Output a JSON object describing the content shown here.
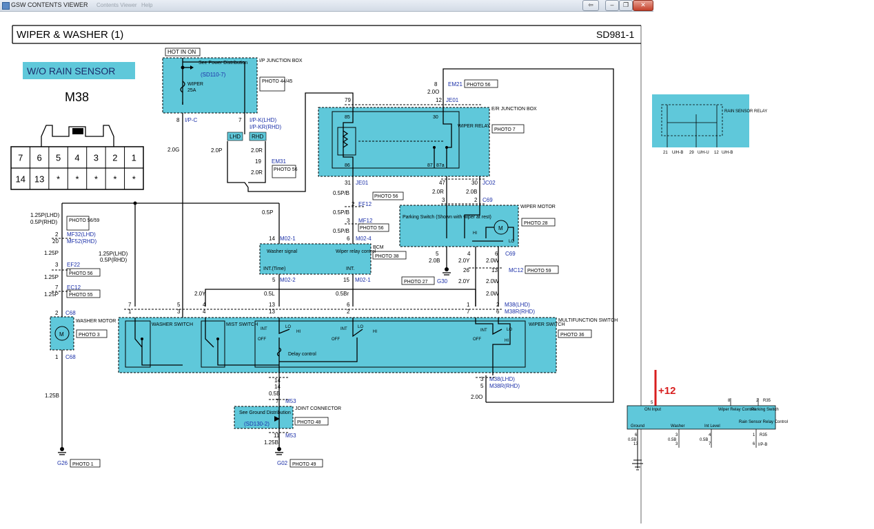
{
  "window": {
    "app_title": "GSW CONTENTS VIEWER",
    "faded_tabs": [
      "Contents Viewer",
      "Help"
    ],
    "controls": [
      "⇦",
      "⇨",
      "–",
      "❐",
      "✕"
    ]
  },
  "header": {
    "title": "WIPER & WASHER (1)",
    "code": "SD981-1"
  },
  "connector_view": {
    "variant_label": "W/O RAIN SENSOR",
    "connector_id": "M38",
    "pin_row1": [
      "7",
      "6",
      "5",
      "4",
      "3",
      "2",
      "1"
    ],
    "pin_row2": [
      "14",
      "13",
      "*",
      "*",
      "*",
      "*",
      "*"
    ]
  },
  "ip_junction": {
    "hot_label": "HOT IN ON",
    "box_name": "I/P JUNCTION BOX",
    "see_power": "See Power Distribution",
    "see_power_ref": "(SD110-7)",
    "fuse_name": "WIPER",
    "fuse_amp": "25A",
    "photo": "PHOTO 44/45"
  },
  "er_junction": {
    "box_name": "E/R JUNCTION BOX",
    "photo": "PHOTO 7",
    "relay_name": "WIPER RELAY"
  },
  "wiper_motor": {
    "name": "WIPER MOTOR",
    "photo": "PHOTO 28",
    "parking_switch": "Parking Switch (Shown with wiper at rest)",
    "motor_symbol": "M",
    "hi": "HI",
    "lo": "LO"
  },
  "bcm": {
    "name": "BCM",
    "photo": "PHOTO 38",
    "washer_signal": "Washer signal",
    "wiper_relay_control": "Wiper relay control",
    "int_time": "INT.(Time)",
    "int": "INT."
  },
  "washer_motor": {
    "name": "WASHER MOTOR",
    "photo": "PHOTO 3",
    "symbol": "M"
  },
  "multifunction": {
    "name": "MULTIFUNCTION SWITCH",
    "photo": "PHOTO 36",
    "washer_switch": "WASHER SWITCH",
    "mist_switch": "MIST SWITCH",
    "wiper_switch": "WIPER SWITCH",
    "delay_control": "Delay control",
    "int": "INT",
    "lo": "LO",
    "hi": "HI",
    "off": "OFF"
  },
  "joint_connector": {
    "name": "JOINT CONNECTOR",
    "photo": "PHOTO 48",
    "see_ground": "See Ground Distribution",
    "ref": "(SD130-2)"
  },
  "grounds": [
    {
      "id": "G26",
      "photo": "PHOTO 1"
    },
    {
      "id": "G02",
      "photo": "PHOTO 49"
    },
    {
      "id": "G30",
      "photo": "PHOTO 27"
    }
  ],
  "wire_labels": {
    "w1": "8",
    "w2": "I/P-C",
    "w3": "7",
    "w4": "I/P-K(LHD)",
    "w5": "I/P-KR(RHD)",
    "w6": "LHD",
    "w7": "RHD",
    "w8": "2.0P",
    "w9": "2.0R",
    "w10": "19",
    "w11": "EM31",
    "w12": "PHOTO 56",
    "w13": "2.0R",
    "w14": "2.0G",
    "w15": "8",
    "w16": "EM21",
    "w17": "PHOTO 56",
    "w18": "2.0O",
    "w19": "12",
    "w20": "JE01",
    "w21": "79",
    "w22": "85",
    "w23": "30",
    "w24": "86",
    "w25": "87",
    "w26": "87a",
    "w27": "31",
    "w28": "JE01",
    "w29": "PHOTO 56",
    "w30": "0.5P/B",
    "w31": "2",
    "w32": "EF12",
    "w33": "0.5P/B",
    "w34": "3",
    "w35": "MF12",
    "w36": "PHOTO 56",
    "w37": "0.5P/B",
    "w38": "6",
    "w39": "M02-4",
    "w40": "47",
    "w41": "30",
    "w42": "JC02",
    "w43": "2.0R",
    "w44": "2.0B",
    "w45": "3",
    "w46": "2",
    "w47": "C69",
    "w48": "0.5P",
    "w49": "14",
    "w50": "M02-1",
    "w51": "1.25P(LHD)",
    "w52": "0.5P(RHD)",
    "w53": "PHOTO 56/59",
    "w54": "2",
    "w55": "MF32(LHD)",
    "w56": "20",
    "w57": "MF52(RHD)",
    "w58": "1.25P",
    "w59": "1.25P(LHD)",
    "w60": "0.5P(RHD)",
    "w61": "3",
    "w62": "EF22",
    "w63": "PHOTO 56",
    "w64": "1.25P",
    "w65": "7",
    "w66": "EC12",
    "w67": "PHOTO 55",
    "w68": "1.25P",
    "w69": "2",
    "w70": "C68",
    "w71": "1",
    "w72": "C68",
    "w73": "1.25B",
    "w74": "5",
    "w75": "M02-2",
    "w76": "15",
    "w77": "M02-1",
    "w78": "5",
    "w79": "4",
    "w80": "6",
    "w81": "C69",
    "w82": "2.0B",
    "w83": "2.0Y",
    "w84": "2.0W",
    "w85": "26",
    "w86": "13",
    "w87": "MC12",
    "w88": "PHOTO 59",
    "w89": "2.0Y",
    "w90": "2.0W",
    "w91": "2.0Y",
    "w92": "0.5L",
    "w93": "0.5Br",
    "w94": "7",
    "w95": "1",
    "w96": "5",
    "w97": "3",
    "w98": "4",
    "w99": "4",
    "w100": "13",
    "w101": "13",
    "w102": "6",
    "w103": "2",
    "w104": "1",
    "w105": "7",
    "w106": "2",
    "w107": "6",
    "w108": "M38(LHD)",
    "w109": "M38R(RHD)",
    "w110": "14",
    "w111": "14",
    "w112": "0.5B",
    "w113": "7",
    "w114": "M53",
    "w115": "3",
    "w116": "5",
    "w117": "M38(LHD)",
    "w118": "M38R(RHD)",
    "w119": "2.0O",
    "w120": "11",
    "w121": "M53",
    "w122": "1.25B"
  },
  "rain_sensor_relay": {
    "name": "RAIN SENSOR RELAY",
    "pins": [
      "21",
      "U/H-B",
      "29",
      "U/H-U",
      "12",
      "U/H-B"
    ]
  },
  "module_detail": {
    "plus12": "+12",
    "on_input": "ON Input",
    "pin_on": "5",
    "pin_wiper": "8",
    "pin_parking": "2",
    "r35_top": "R35",
    "wiper_relay_control": "Wiper Relay Control",
    "parking_switch": "Parking Switch",
    "ground": "Ground",
    "washer": "Washer",
    "int_level": "Int Level",
    "rain_sensor_relay_control": "Rain Sensor Relay Control",
    "bottom_pins": [
      "6",
      "13",
      "3",
      "3",
      "4",
      "7",
      "1",
      "6"
    ],
    "wire_sizes": [
      "0.5B",
      "0.5B",
      "0.5B"
    ],
    "r35_bottom": "R35",
    "ipb": "I/P-B"
  },
  "colors": {
    "cyan": "#5fc8da",
    "blue_text": "#1a2fa8",
    "red": "#d81f1f"
  }
}
